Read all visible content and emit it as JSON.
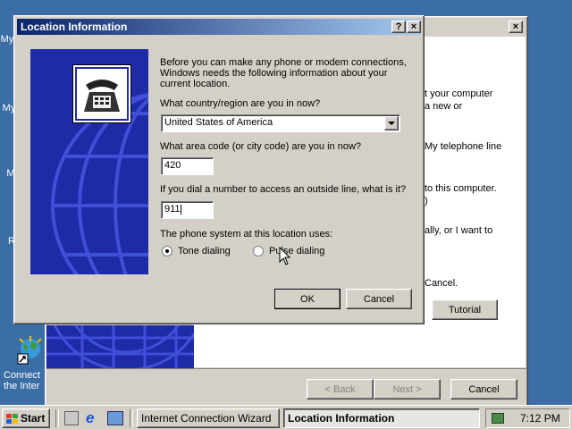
{
  "desktop": {
    "icons": [
      {
        "label": "My"
      },
      {
        "label": "My"
      },
      {
        "label": "M"
      },
      {
        "label": "R"
      }
    ],
    "connect_icon": {
      "line1": "Connect",
      "line2": "the Inter"
    }
  },
  "wizard": {
    "close_label": "×",
    "partial_text": [
      "t your computer",
      "a new or",
      "My telephone line",
      "to this computer.",
      ")",
      "ally, or I want to",
      "Cancel."
    ],
    "tutorial_label": "Tutorial",
    "back_label": "< Back",
    "next_label": "Next >",
    "cancel_label": "Cancel"
  },
  "dialog": {
    "title": "Location Information",
    "help_label": "?",
    "close_label": "×",
    "intro": "Before you can make any phone or modem connections, Windows needs the following information about your current location.",
    "country_question": "What country/region are you in now?",
    "country_value": "United States of America",
    "area_question": "What area code (or city code) are you in now?",
    "area_value": "420",
    "outside_question": "If you dial a number to access an outside line, what is it?",
    "outside_value": "911",
    "phone_system_label": "The phone system at this location uses:",
    "tone_label": "Tone dialing",
    "pulse_label": "Pulse dialing",
    "selected_dialing": "tone",
    "ok_label": "OK",
    "cancel_label": "Cancel"
  },
  "taskbar": {
    "start_label": "Start",
    "tasks": [
      {
        "label": "Internet Connection Wizard",
        "active": false
      },
      {
        "label": "Location Information",
        "active": true
      }
    ],
    "time": "7:12 PM"
  }
}
